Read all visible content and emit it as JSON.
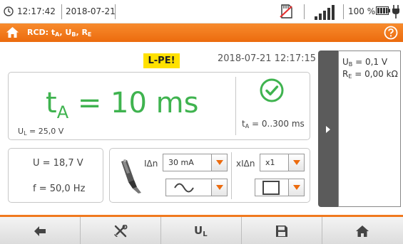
{
  "status": {
    "time": "12:17:42",
    "date": "2018-07-21",
    "battery_pct": "100 %",
    "icons": [
      "clock-icon",
      "no-sd-card-icon",
      "signal-strength-icon",
      "battery-icon",
      "plug-icon"
    ]
  },
  "titlebar": {
    "prefix": "RCD: t",
    "sub_a": "A",
    "mid1": ", U",
    "sub_b": "B",
    "mid2": ", R",
    "sub_e": "E",
    "icons": [
      "home-icon",
      "help-icon"
    ]
  },
  "measurement": {
    "badge": "L-PE!",
    "datetime": "2018-07-21 12:17:15",
    "result_t": "t",
    "result_sub": "A",
    "result_value": " = 10 ms",
    "ul_u": "U",
    "ul_sub": "L",
    "ul_value": " = 25,0 V",
    "range_t": "t",
    "range_sub": "A",
    "range_value": " = 0..300 ms",
    "u_value": "U = 18,7 V",
    "f_value": "f = 50,0 Hz"
  },
  "settings": {
    "idn_label": "IΔn",
    "idn_value": "30 mA",
    "kidn_label": "xIΔn",
    "kidn_value": "x1",
    "waveform": "sine-wave-icon",
    "shape": "square-icon"
  },
  "side": {
    "ub_u": "U",
    "ub_sub": "B",
    "ub_value": " = 0,1 V",
    "re_r": "R",
    "re_sub": "E",
    "re_value": " = 0,00 kΩ"
  },
  "toolbar": {
    "ul_u": "U",
    "ul_sub": "L",
    "icons": [
      "back-arrow-icon",
      "tools-icon",
      "ul-button",
      "save-icon",
      "home-icon"
    ]
  },
  "colors": {
    "accent": "#ec6b0e",
    "result_green": "#3fb34f",
    "badge_yellow": "#ffe100"
  }
}
